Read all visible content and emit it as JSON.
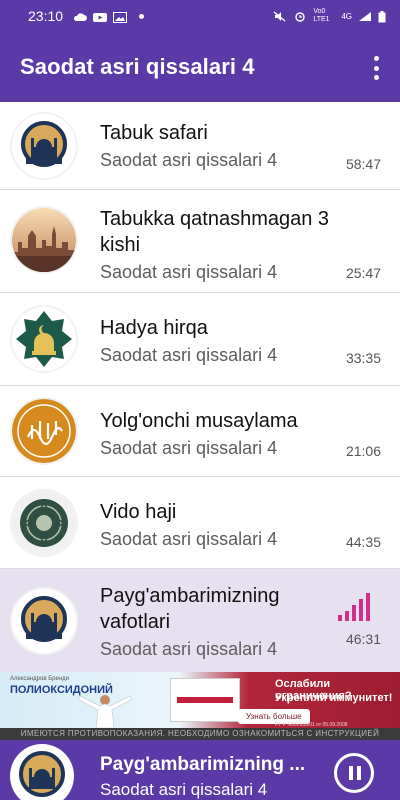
{
  "status_bar": {
    "time": "23:10",
    "left_icons": [
      "cloud-icon",
      "youtube-icon",
      "gallery-icon",
      "dot-icon"
    ],
    "right_icons": [
      "mute-icon",
      "alarm-icon",
      "volte-icon",
      "4g-icon",
      "signal-icon",
      "battery-icon"
    ],
    "volte_label": "Vo0 LTE1",
    "net_label": "4G"
  },
  "app_bar": {
    "title": "Saodat asri qissalari 4",
    "menu_icon": "more-vert-icon"
  },
  "list": {
    "items": [
      {
        "title": "Tabuk safari",
        "subtitle": "Saodat asri qissalari 4",
        "duration": "58:47",
        "thumb_icon": "mosque-badge-icon",
        "playing": false
      },
      {
        "title": "Tabukka qatnashmagan 3 kishi",
        "subtitle": "Saodat asri qissalari 4",
        "duration": "25:47",
        "thumb_icon": "city-sunset-icon",
        "playing": false
      },
      {
        "title": "Hadya hirqa",
        "subtitle": "Saodat asri qissalari 4",
        "duration": "33:35",
        "thumb_icon": "star-mosque-icon",
        "playing": false
      },
      {
        "title": "Yolg'onchi musaylama",
        "subtitle": "Saodat asri qissalari 4",
        "duration": "21:06",
        "thumb_icon": "calligraphy-icon",
        "playing": false
      },
      {
        "title": "Vido haji",
        "subtitle": "Saodat asri qissalari 4",
        "duration": "44:35",
        "thumb_icon": "ornament-icon",
        "playing": false
      },
      {
        "title": "Payg'ambarimizning vafotlari",
        "subtitle": "Saodat asri qissalari 4",
        "duration": "46:31",
        "thumb_icon": "mosque-badge-icon",
        "playing": true,
        "indicator_icon": "equalizer-icon"
      }
    ]
  },
  "ad": {
    "brand_small": "Александров Бренди",
    "brand": "ПОЛИОКСИДОНИЙ",
    "headline_1": "Ослабили ограничения?",
    "headline_2": "Укрепляй иммунитет!",
    "button": "Узнать больше",
    "fine_print": "РУ Р N002935/01 от 05.09.2008",
    "bottom_band": "ИМЕЮТСЯ ПРОТИВОПОКАЗАНИЯ. НЕОБХОДИМО ОЗНАКОМИТЬСЯ С ИНСТРУКЦИЕЙ",
    "colors": {
      "left": "#d6ecf7",
      "right": "#9e1d31"
    }
  },
  "player": {
    "title": "Payg'ambarimizning ...",
    "subtitle": "Saodat asri qissalari 4",
    "button_icon": "pause-icon"
  },
  "colors": {
    "primary": "#5b3aa8",
    "active_row": "#e6e0f1",
    "equalizer": "#d02e8c"
  }
}
